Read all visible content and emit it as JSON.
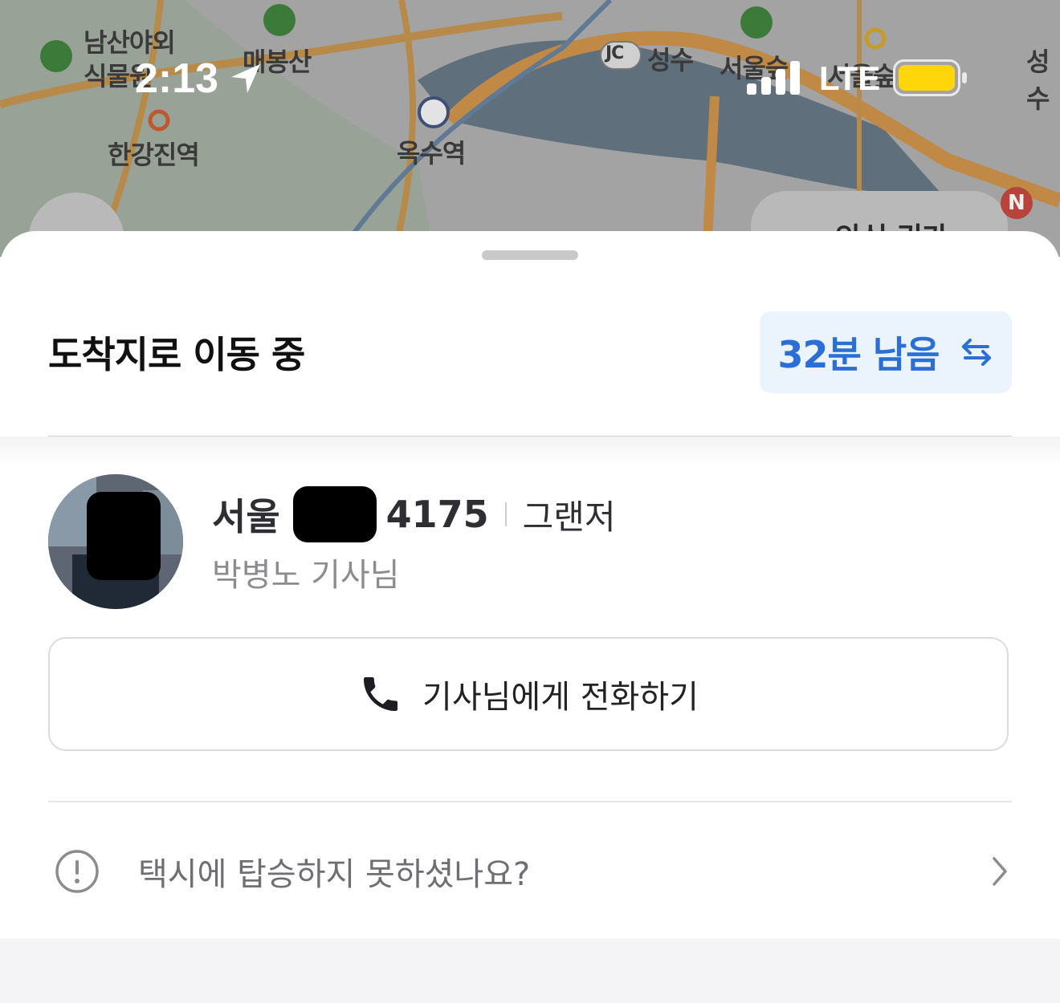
{
  "map": {
    "labels": [
      "남산야외",
      "식물원",
      "매봉산",
      "한강진역",
      "옥수역",
      "성수",
      "서울숲",
      "서울숲",
      "성수"
    ],
    "jc_badge": "JC",
    "safety_badge_text": "안심 귀가",
    "notice_badge": "N"
  },
  "status_bar": {
    "time": "2:13",
    "network": "LTE"
  },
  "sheet": {
    "title": "도착지로 이동 중",
    "eta": "32분 남음",
    "vehicle": {
      "city": "서울",
      "plate_number": "4175",
      "model": "그랜저"
    },
    "driver": "박병노 기사님",
    "call_button": "기사님에게 전화하기",
    "help_link": "택시에 탑승하지 못하셨나요?"
  },
  "colors": {
    "accent_blue": "#2a6ed6",
    "eta_bg": "#ebf3fd",
    "battery_yellow": "#ffd60a"
  },
  "icons": [
    "location-arrow-icon",
    "signal-bars-icon",
    "battery-icon",
    "swap-arrows-icon",
    "phone-icon",
    "exclamation-circle-icon",
    "chevron-right-icon"
  ]
}
